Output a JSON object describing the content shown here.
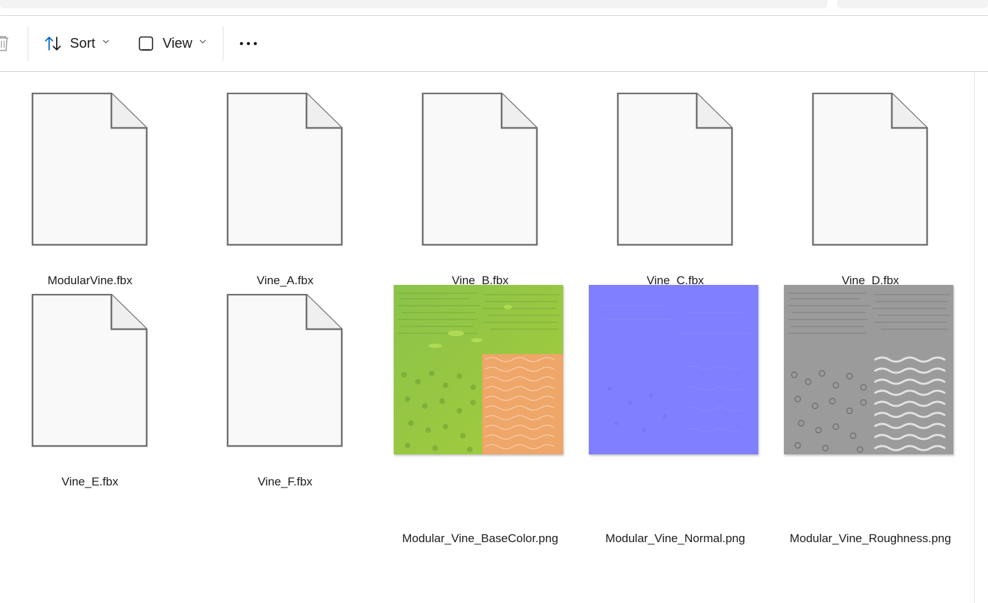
{
  "toolbar": {
    "sort_label": "Sort",
    "view_label": "View",
    "more_label": "•••"
  },
  "files": [
    {
      "name": "ModularVine.fbx",
      "kind": "generic-file"
    },
    {
      "name": "Vine_A.fbx",
      "kind": "generic-file"
    },
    {
      "name": "Vine_B.fbx",
      "kind": "generic-file"
    },
    {
      "name": "Vine_C.fbx",
      "kind": "generic-file"
    },
    {
      "name": "Vine_D.fbx",
      "kind": "generic-file"
    },
    {
      "name": "Vine_E.fbx",
      "kind": "generic-file"
    },
    {
      "name": "Vine_F.fbx",
      "kind": "generic-file"
    },
    {
      "name": "Modular_Vine_BaseColor.png",
      "kind": "image",
      "preview": "basecolor"
    },
    {
      "name": "Modular_Vine_Normal.png",
      "kind": "image",
      "preview": "normal"
    },
    {
      "name": "Modular_Vine_Roughness.png",
      "kind": "image",
      "preview": "roughness"
    }
  ],
  "colors": {
    "accent": "#0067c0",
    "file_outline": "#707070",
    "file_fill": "#f9f9f9",
    "basecolor_green": "#8cc63f",
    "basecolor_orange": "#f0a36a",
    "normal_blue": "#7f7fff",
    "roughness_gray": "#9a9a9a"
  }
}
